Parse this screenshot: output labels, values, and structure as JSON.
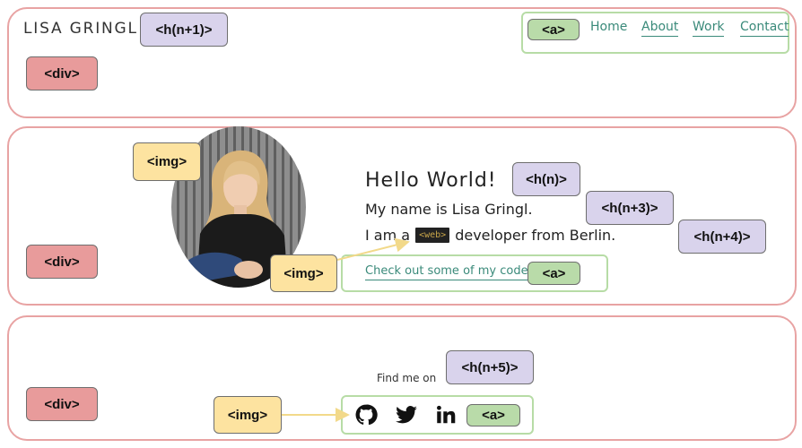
{
  "header": {
    "logo": "LISA GRINGL",
    "nav": [
      {
        "label": "Home"
      },
      {
        "label": "About"
      },
      {
        "label": "Work"
      },
      {
        "label": "Contact"
      }
    ]
  },
  "hero": {
    "greeting": "Hello World!",
    "intro": "My name is Lisa Gringl.",
    "role_prefix": "I am a",
    "role_chip": "<web>",
    "role_suffix": "developer from Berlin.",
    "cta_link": "Check out some of my code"
  },
  "footer": {
    "find_me": "Find me on",
    "social_icons": [
      "github-icon",
      "twitter-icon",
      "linkedin-icon"
    ]
  },
  "tags": {
    "div": "<div>",
    "h_n1": "<h(n+1)>",
    "h_n": "<h(n)>",
    "h_n3": "<h(n+3)>",
    "h_n4": "<h(n+4)>",
    "h_n5": "<h(n+5)>",
    "img": "<img>",
    "a": "<a>"
  },
  "colors": {
    "section_border": "#e8a3a3",
    "div_tag": "#e89b9b",
    "heading_tag": "#d9d3ec",
    "img_tag": "#fde3a0",
    "anchor_tag": "#b9dba9",
    "link_text": "#3a8a7a",
    "arrow": "#f2d98a"
  }
}
